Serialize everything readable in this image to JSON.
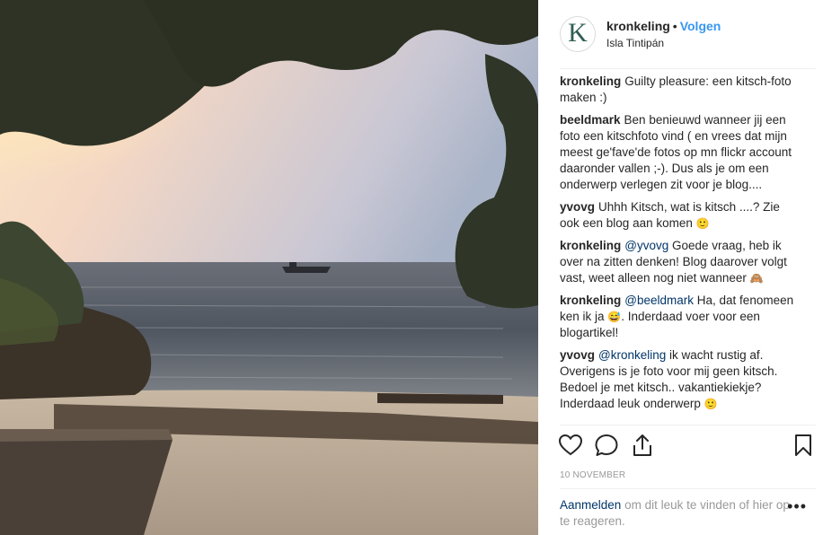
{
  "post": {
    "username": "kronkeling",
    "avatar_letter": "K",
    "separator": "•",
    "follow_label": "Volgen",
    "location": "Isla Tintipán",
    "date": "10 NOVEMBER"
  },
  "comments": [
    {
      "user": "kronkeling",
      "mention": "",
      "text": "Guilty pleasure: een kitsch-foto maken :)",
      "emoji": ""
    },
    {
      "user": "beeldmark",
      "mention": "",
      "text": "Ben benieuwd wanneer jij een foto een kitschfoto vind ( en vrees dat mijn meest ge'fave'de fotos op mn flickr account daaronder vallen ;-). Dus als je om een onderwerp verlegen zit voor je blog....",
      "emoji": ""
    },
    {
      "user": "yvovg",
      "mention": "",
      "text": "Uhhh Kitsch, wat is kitsch ....? Zie ook een blog aan komen",
      "emoji": "🙂"
    },
    {
      "user": "kronkeling",
      "mention": "@yvovg",
      "text": "Goede vraag, heb ik over na zitten denken! Blog daarover volgt vast, weet alleen nog niet wanneer",
      "emoji": "🙈"
    },
    {
      "user": "kronkeling",
      "mention": "@beeldmark",
      "text": "Ha, dat fenomeen ken ik ja",
      "emoji": "😅",
      "text_after": ". Inderdaad voer voor een blogartikel!"
    },
    {
      "user": "yvovg",
      "mention": "@kronkeling",
      "text": "ik wacht rustig af. Overigens is je foto voor mij geen kitsch. Bedoel je met kitsch.. vakantiekiekje? Inderdaad leuk onderwerp",
      "emoji": "🙂"
    }
  ],
  "actions": {
    "like_icon": "heart-icon",
    "comment_icon": "comment-icon",
    "share_icon": "share-icon",
    "save_icon": "bookmark-icon"
  },
  "login_prompt": {
    "link": "Aanmelden",
    "text": "om dit leuk te vinden of hier op te reageren.",
    "more": "•••"
  },
  "colors": {
    "link_blue": "#3897f0",
    "mention_blue": "#003569",
    "muted": "#999999"
  }
}
